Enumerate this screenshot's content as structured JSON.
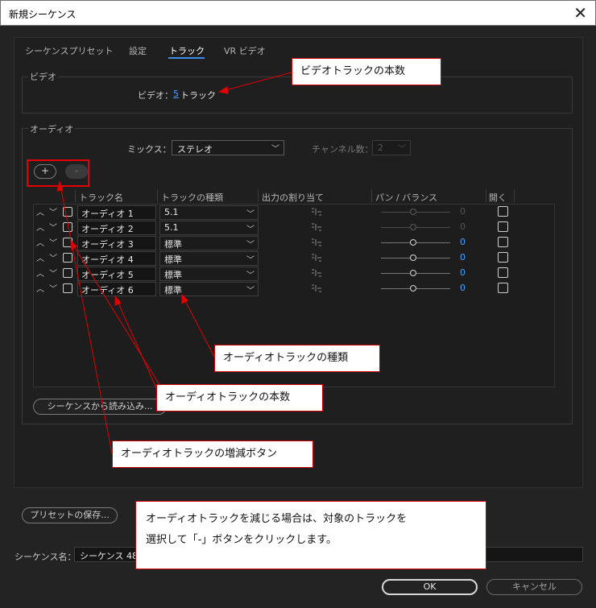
{
  "window": {
    "title": "新規シーケンス",
    "close_glyph": "✕"
  },
  "tabs": [
    {
      "label": "シーケンスプリセット",
      "active": false
    },
    {
      "label": "設定",
      "active": false
    },
    {
      "label": "トラック",
      "active": true
    },
    {
      "label": "VR ビデオ",
      "active": false
    }
  ],
  "video": {
    "group_label": "ビデオ",
    "label": "ビデオ：",
    "count": "5",
    "unit": "トラック"
  },
  "audio": {
    "group_label": "オーディオ",
    "mix_label": "ミックス：",
    "mix_value": "ステレオ",
    "channels_label": "チャンネル数：",
    "channels_value": "2",
    "add_glyph": "+",
    "remove_glyph": "-",
    "columns": [
      "トラック名",
      "トラックの種類",
      "出力の割り当て",
      "パン / バランス",
      "開く"
    ],
    "tracks": [
      {
        "name": "オーディオ 1",
        "type": "5.1",
        "pan": "0",
        "pan_enabled": false
      },
      {
        "name": "オーディオ 2",
        "type": "5.1",
        "pan": "0",
        "pan_enabled": false
      },
      {
        "name": "オーディオ 3",
        "type": "標準",
        "pan": "0",
        "pan_enabled": true
      },
      {
        "name": "オーディオ 4",
        "type": "標準",
        "pan": "0",
        "pan_enabled": true
      },
      {
        "name": "オーディオ 5",
        "type": "標準",
        "pan": "0",
        "pan_enabled": true
      },
      {
        "name": "オーディオ 6",
        "type": "標準",
        "pan": "0",
        "pan_enabled": true
      }
    ],
    "import_button": "シーケンスから読み込み..."
  },
  "preset_save_button": "プリセットの保存...",
  "sequence_name": {
    "label": "シーケンス名：",
    "value": "シーケンス 48"
  },
  "ok_button": "OK",
  "cancel_button": "キャンセル",
  "annotations": {
    "video_count": "ビデオトラックの本数",
    "audio_type": "オーディオトラックの種類",
    "audio_count": "オーディオトラックの本数",
    "audio_addremove": "オーディオトラックの増減ボタン",
    "note_line1": "オーディオトラックを減じる場合は、対象のトラックを",
    "note_line2": "選択して「-」ボタンをクリックします。"
  },
  "colors": {
    "accent": "#3a8ee6",
    "link": "#4aa3ff",
    "annotation_red": "#e00000"
  }
}
